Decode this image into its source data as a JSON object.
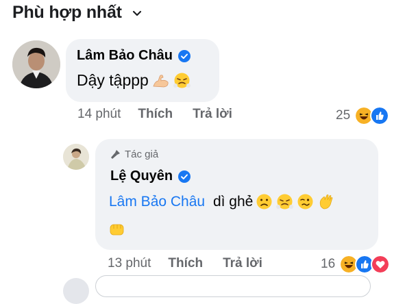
{
  "sort": {
    "label": "Phù hợp nhất",
    "icon": "chevron-down-icon"
  },
  "comments": [
    {
      "author": "Lâm Bảo Châu",
      "verified": true,
      "text": "Dậy tậppp",
      "emojis": [
        "flexed-biceps-icon",
        "steam-from-nose-icon"
      ],
      "time": "14 phút",
      "like_label": "Thích",
      "reply_label": "Trả lời",
      "reaction_count": "25",
      "reactions": [
        "haha-icon",
        "like-icon"
      ]
    },
    {
      "author_badge": "Tác giả",
      "author": "Lệ Quyên",
      "verified": true,
      "mention": "Lâm Bảo Châu",
      "text": "dì ghẻ",
      "emojis": [
        "worried-face-icon",
        "steam-from-nose-icon",
        "woozy-face-icon",
        "waving-hand-icon",
        "fist-bump-icon"
      ],
      "time": "13 phút",
      "like_label": "Thích",
      "reply_label": "Trả lời",
      "reaction_count": "16",
      "reactions": [
        "haha-icon",
        "like-icon",
        "love-icon"
      ]
    }
  ],
  "colors": {
    "accent": "#1877f2",
    "bubble": "#f0f2f5",
    "meta": "#65676b"
  }
}
